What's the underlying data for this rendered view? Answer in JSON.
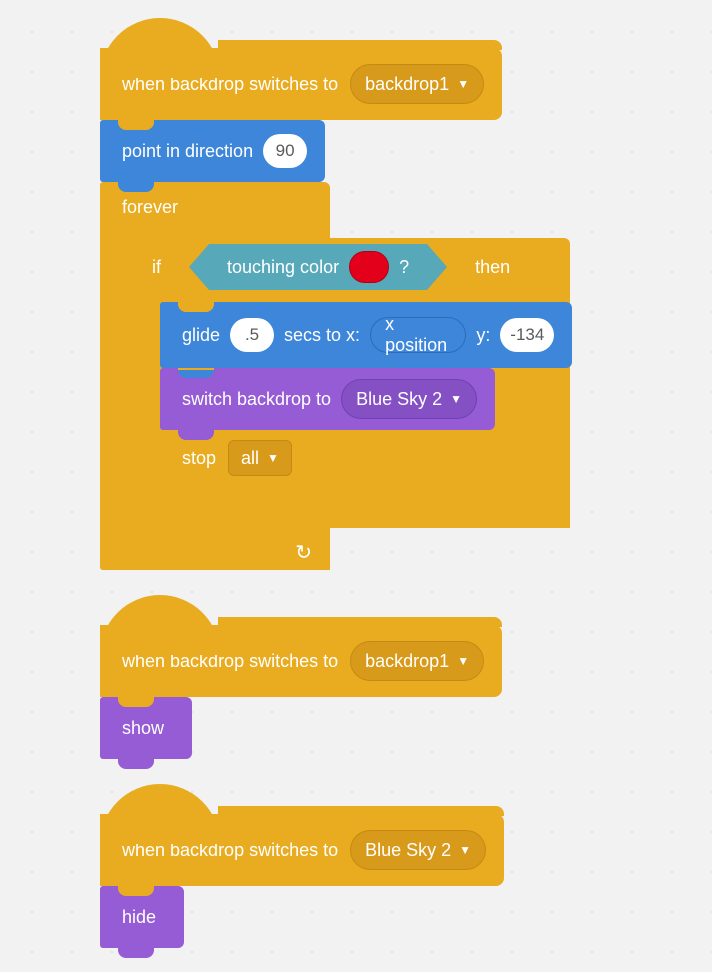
{
  "scripts": [
    {
      "hat": {
        "label": "when backdrop switches to",
        "dropdown": "backdrop1"
      },
      "blocks": [
        {
          "kind": "motion",
          "name": "point-in-direction",
          "label": "point in direction",
          "value": "90"
        },
        {
          "kind": "forever",
          "label": "forever",
          "body": [
            {
              "kind": "if",
              "label_pre": "if",
              "label_post": "then",
              "condition": {
                "label_pre": "touching color",
                "label_post": "?",
                "color": "#e3001b"
              },
              "body": [
                {
                  "kind": "motion",
                  "name": "glide",
                  "label_a": "glide",
                  "secs": ".5",
                  "label_b": "secs to x:",
                  "x_reporter": "x position",
                  "label_c": "y:",
                  "y": "-134"
                },
                {
                  "kind": "looks",
                  "name": "switch-backdrop",
                  "label": "switch backdrop to",
                  "dropdown": "Blue Sky 2"
                },
                {
                  "kind": "control-cap",
                  "name": "stop",
                  "label": "stop",
                  "dropdown": "all"
                }
              ]
            }
          ]
        }
      ]
    },
    {
      "hat": {
        "label": "when backdrop switches to",
        "dropdown": "backdrop1"
      },
      "blocks": [
        {
          "kind": "looks-simple",
          "name": "show",
          "label": "show"
        }
      ]
    },
    {
      "hat": {
        "label": "when backdrop switches to",
        "dropdown": "Blue Sky 2"
      },
      "blocks": [
        {
          "kind": "looks-simple",
          "name": "hide",
          "label": "hide"
        }
      ]
    }
  ]
}
